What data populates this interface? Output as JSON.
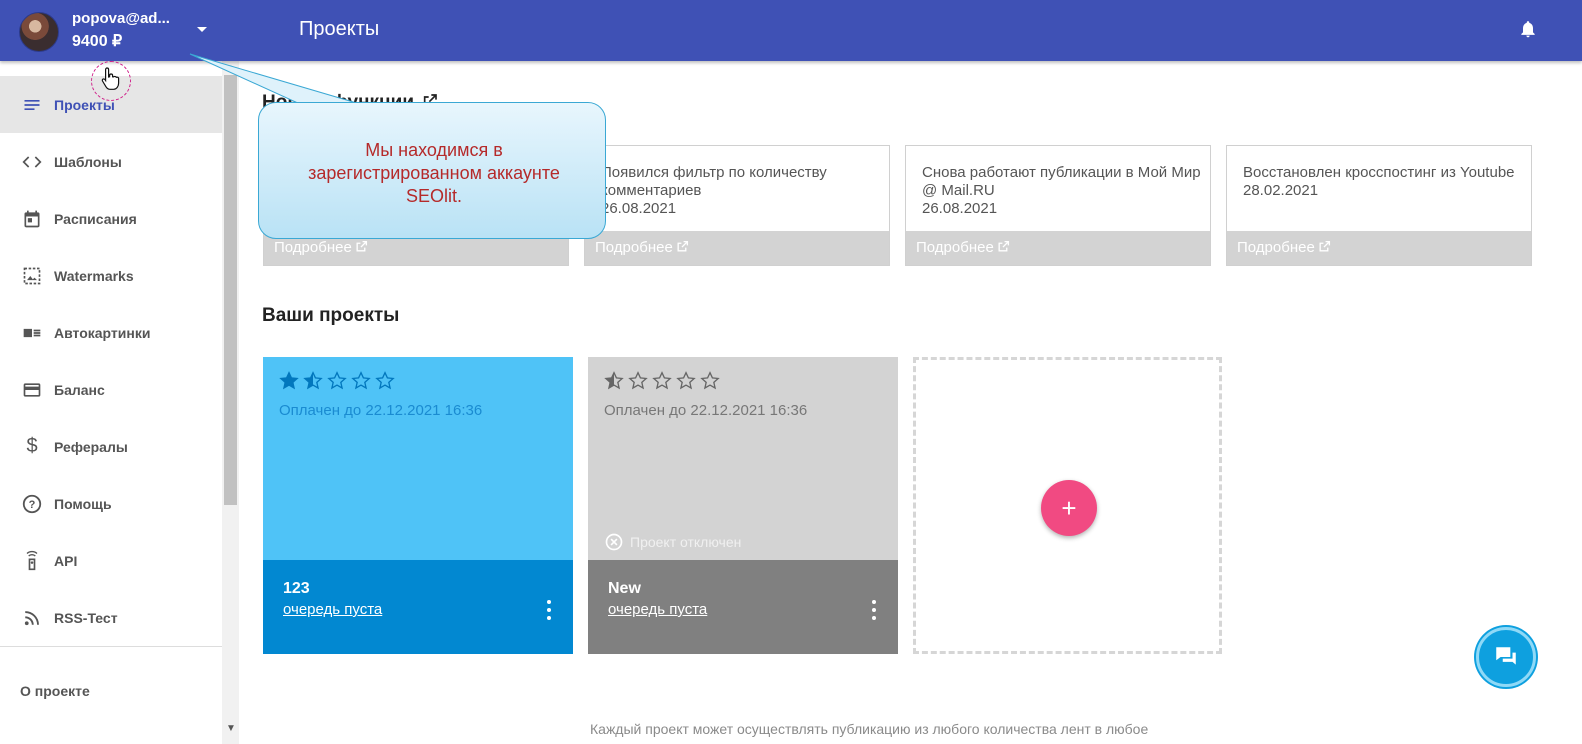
{
  "header": {
    "user_email": "popova@ad...",
    "balance": "9400 ₽",
    "page_title": "Проекты"
  },
  "sidebar": {
    "items": [
      {
        "label": "Проекты",
        "icon": "list-icon",
        "active": true
      },
      {
        "label": "Шаблоны",
        "icon": "code-icon"
      },
      {
        "label": "Расписания",
        "icon": "calendar-icon"
      },
      {
        "label": "Watermarks",
        "icon": "image-icon"
      },
      {
        "label": "Автокартинки",
        "icon": "autopicture-icon"
      },
      {
        "label": "Баланс",
        "icon": "credit-card-icon"
      },
      {
        "label": "Рефералы",
        "icon": "dollar-icon"
      },
      {
        "label": "Помощь",
        "icon": "help-icon"
      },
      {
        "label": "API",
        "icon": "api-icon"
      },
      {
        "label": "RSS-Тест",
        "icon": "rss-icon"
      }
    ],
    "about": "О проекте"
  },
  "news": {
    "title": "Новые функции",
    "more_label": "Подробнее",
    "cards": [
      {
        "text": "",
        "date": ""
      },
      {
        "text": "Появился фильтр по количеству комментариев",
        "date": "26.08.2021"
      },
      {
        "text": "Снова работают публикации в Мой Мир @ Mail.RU",
        "date": "26.08.2021"
      },
      {
        "text": "Восстановлен кросспостинг из Youtube",
        "date": "28.02.2021"
      }
    ]
  },
  "projects": {
    "title": "Ваши проекты",
    "items": [
      {
        "name": "123",
        "paid_until": "Оплачен до 22.12.2021 16:36",
        "queue": "очередь пуста",
        "rating": 1.5,
        "rating_max": 5,
        "color": "#4fc3f7",
        "footer_color": "#0288d1"
      },
      {
        "name": "New",
        "paid_until": "Оплачен до 22.12.2021 16:36",
        "queue": "очередь пуста",
        "rating": 0.5,
        "rating_max": 5,
        "status": "Проект отключен",
        "color": "#d3d3d3",
        "footer_color": "#808080"
      }
    ],
    "add_label": "+",
    "footnote": "Каждый проект может осуществлять публикацию из любого количества лент в любое"
  },
  "callout": {
    "text": "Мы находимся в зарегистрированном аккаунте SEOlit."
  },
  "colors": {
    "header": "#3f51b5",
    "accent_pink": "#f14a82",
    "chat": "#0ea0df"
  }
}
